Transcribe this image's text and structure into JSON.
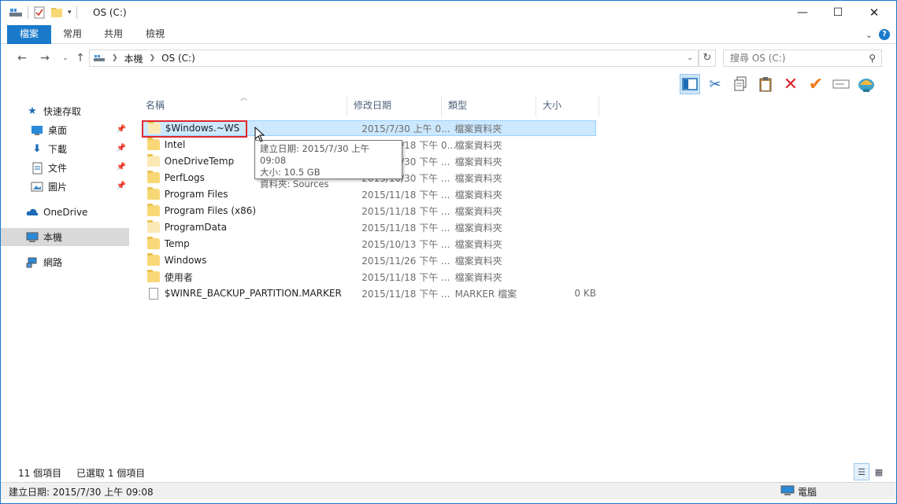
{
  "window": {
    "title": "OS (C:)",
    "minimize_glyph": "—",
    "maximize_glyph": "☐",
    "close_glyph": "✕"
  },
  "ribbon": {
    "tabs": [
      {
        "label": "檔案"
      },
      {
        "label": "常用"
      },
      {
        "label": "共用"
      },
      {
        "label": "檢視"
      }
    ],
    "help_glyph": "?",
    "collapse_glyph": "⌄"
  },
  "address": {
    "crumbs": [
      "本機",
      "OS (C:)"
    ],
    "search_placeholder": "搜尋 OS (C:)"
  },
  "toolbar": {
    "icons": [
      "details-pane-icon",
      "cut-icon",
      "copy-icon",
      "paste-icon",
      "delete-icon",
      "check-icon",
      "rename-icon",
      "shell-icon"
    ]
  },
  "navpane": {
    "quick_access": "快速存取",
    "items": [
      {
        "label": "桌面",
        "icon": "desktop-icon"
      },
      {
        "label": "下載",
        "icon": "download-icon"
      },
      {
        "label": "文件",
        "icon": "documents-icon"
      },
      {
        "label": "圖片",
        "icon": "pictures-icon"
      }
    ],
    "onedrive": "OneDrive",
    "thispc": "本機",
    "network": "網路"
  },
  "filelist": {
    "columns": {
      "name": "名稱",
      "date": "修改日期",
      "type": "類型",
      "size": "大小"
    },
    "rows": [
      {
        "name": "$Windows.~WS",
        "date": "2015/7/30 上午 0...",
        "type": "檔案資料夾",
        "size": "",
        "kind": "folder-pale",
        "selected": true
      },
      {
        "name": "Intel",
        "date": "2015/11/18 下午 0...",
        "type": "檔案資料夾",
        "size": "",
        "kind": "folder"
      },
      {
        "name": "OneDriveTemp",
        "date": "2015/10/30 下午 ...",
        "type": "檔案資料夾",
        "size": "",
        "kind": "folder-pale"
      },
      {
        "name": "PerfLogs",
        "date": "2015/10/30 下午 ...",
        "type": "檔案資料夾",
        "size": "",
        "kind": "folder"
      },
      {
        "name": "Program Files",
        "date": "2015/11/18 下午 ...",
        "type": "檔案資料夾",
        "size": "",
        "kind": "folder"
      },
      {
        "name": "Program Files (x86)",
        "date": "2015/11/18 下午 ...",
        "type": "檔案資料夾",
        "size": "",
        "kind": "folder"
      },
      {
        "name": "ProgramData",
        "date": "2015/11/18 下午 ...",
        "type": "檔案資料夾",
        "size": "",
        "kind": "folder-pale"
      },
      {
        "name": "Temp",
        "date": "2015/10/13 下午 ...",
        "type": "檔案資料夾",
        "size": "",
        "kind": "folder"
      },
      {
        "name": "Windows",
        "date": "2015/11/26 下午 ...",
        "type": "檔案資料夾",
        "size": "",
        "kind": "folder"
      },
      {
        "name": "使用者",
        "date": "2015/11/18 下午 ...",
        "type": "檔案資料夾",
        "size": "",
        "kind": "folder"
      },
      {
        "name": "$WINRE_BACKUP_PARTITION.MARKER",
        "date": "2015/11/18 下午 ...",
        "type": "MARKER 檔案",
        "size": "0 KB",
        "kind": "file"
      }
    ]
  },
  "tooltip": {
    "line1": "建立日期: 2015/7/30 上午 09:08",
    "line2": "大小: 10.5 GB",
    "line3": "資料夾: Sources"
  },
  "status": {
    "count": "11 個項目",
    "selected": "已選取 1 個項目",
    "detail": "建立日期: 2015/7/30 上午 09:08",
    "location": "電腦"
  },
  "colors": {
    "accent": "#1979ca",
    "selection": "#cce8ff",
    "highlight_box": "#e0262c"
  }
}
